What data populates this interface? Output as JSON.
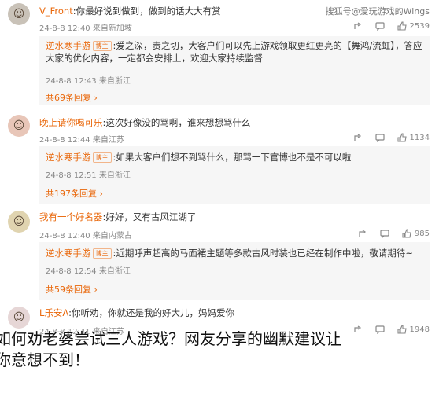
{
  "watermark": "搜狐号@爱玩游戏的Wings",
  "comments": [
    {
      "username": "V_Front",
      "text": ":你最好说到做到，做到的话大大有赏",
      "date": "24-8-8 12:40",
      "location": "来自新加坡",
      "likes": "2539",
      "reply": {
        "author": "逆水寒手游",
        "badge": "博主",
        "text": ":爱之深，责之切，大客户们可以先上游戏领取更红更亮的【舞鸿/流虹】，答应大家的优化内容，一定都会安排上，欢迎大家持续监督",
        "date": "24-8-8 12:43",
        "location": "来自浙江"
      },
      "total": "共69条回复"
    },
    {
      "username": "晚上请你喝可乐",
      "text": ":这次好像没的骂啊，谁来想想骂什么",
      "date": "24-8-8 12:44",
      "location": "来自江苏",
      "likes": "1134",
      "reply": {
        "author": "逆水寒手游",
        "badge": "博主",
        "text": ":如果大客户们想不到骂什么，那骂一下官博也不是不可以啦",
        "date": "24-8-8 12:51",
        "location": "来自浙江"
      },
      "total": "共197条回复"
    },
    {
      "username": "我有一个好名器",
      "text": ":好好，又有古风江湖了",
      "date": "24-8-8 12:40",
      "location": "来自内蒙古",
      "likes": "985",
      "reply": {
        "author": "逆水寒手游",
        "badge": "博主",
        "text": ":近期呼声超高的马面裙主题等多款古风时装也已经在制作中啦，敬请期待~",
        "date": "24-8-8 12:54",
        "location": "来自浙江"
      },
      "total": "共59条回复"
    },
    {
      "username": "L乐安A",
      "text": ":你听劝，你就还是我的好大儿，妈妈爱你",
      "date": "24-8-8 12:41",
      "location": "来自江苏",
      "likes": "1948"
    }
  ],
  "caption": {
    "line1": "如何劝老婆尝试三人游戏？网友分享的幽默建议让",
    "line2": "你意想不到！"
  }
}
